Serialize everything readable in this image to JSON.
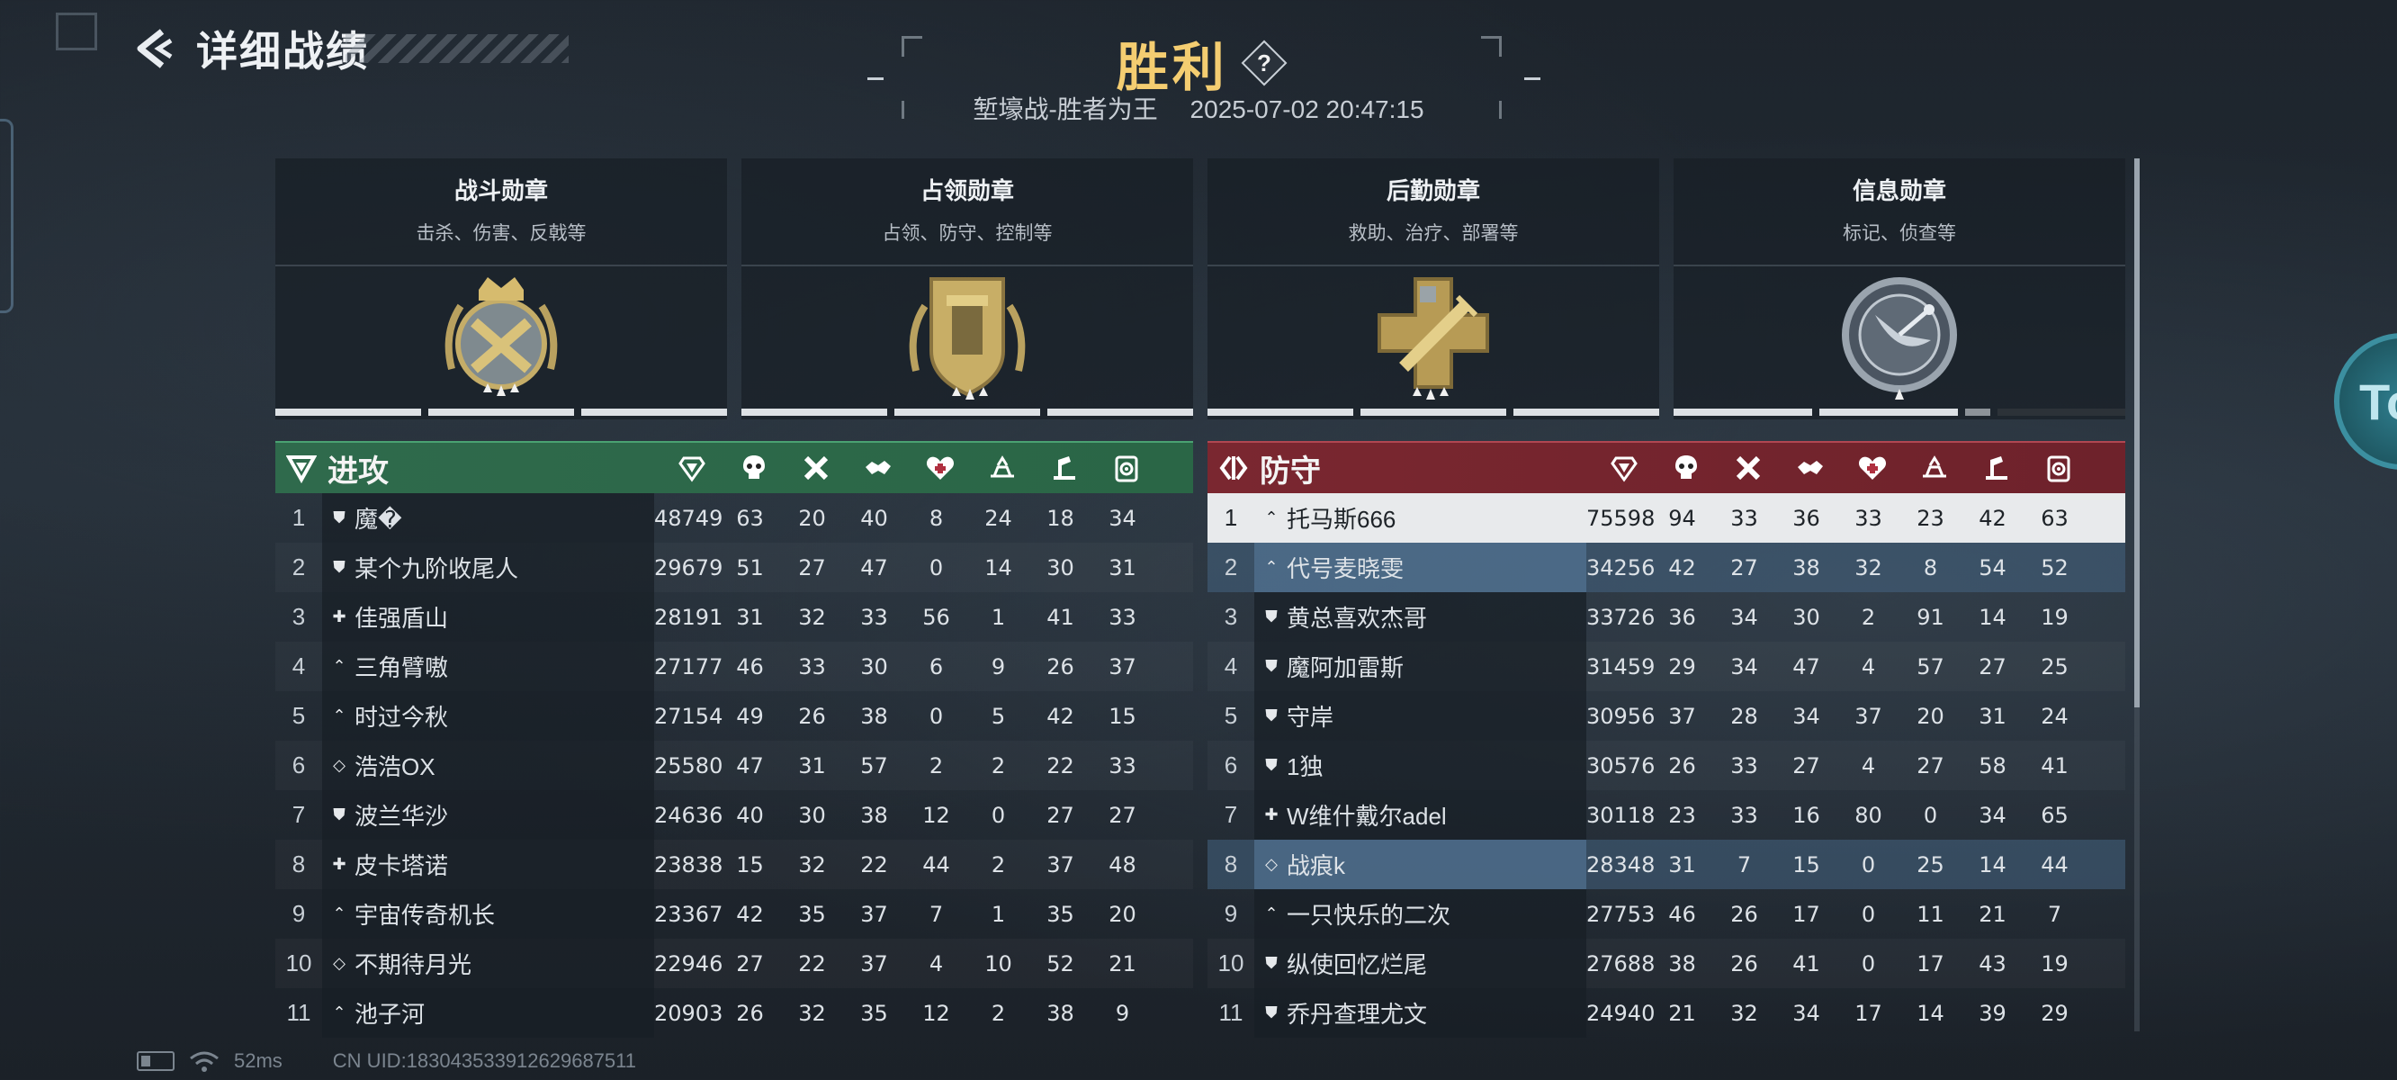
{
  "header": {
    "back_icon": "back-arrow-icon",
    "title": "详细战绩"
  },
  "result": {
    "title": "胜利",
    "help_label": "?",
    "mode": "堑壕战-胜者为王",
    "datetime": "2025-07-02 20:47:15"
  },
  "medals": [
    {
      "name": "战斗勋章",
      "desc": "击杀、伤害、反戟等",
      "icon": "combat-medal-icon",
      "segments_filled": 3
    },
    {
      "name": "占领勋章",
      "desc": "占领、防守、控制等",
      "icon": "capture-medal-icon",
      "segments_filled": 3
    },
    {
      "name": "后勤勋章",
      "desc": "救助、治疗、部署等",
      "icon": "logistics-medal-icon",
      "segments_filled": 3
    },
    {
      "name": "信息勋章",
      "desc": "标记、侦查等",
      "icon": "intel-medal-icon",
      "segments_filled": 2.15
    }
  ],
  "column_icons": [
    "score-icon",
    "kills-icon",
    "deaths-icon",
    "assists-icon",
    "revives-icon",
    "capture-icon",
    "support-icon",
    "intel-icon"
  ],
  "attack": {
    "name": "进攻",
    "color": "#2f6a4c",
    "rows": [
      {
        "rank": "1",
        "role": "shield",
        "name": "魔�",
        "stats": [
          "48749",
          "63",
          "20",
          "40",
          "8",
          "24",
          "18",
          "34"
        ]
      },
      {
        "rank": "2",
        "role": "shield",
        "name": "某个九阶收尾人",
        "stats": [
          "29679",
          "51",
          "27",
          "47",
          "0",
          "14",
          "30",
          "31"
        ]
      },
      {
        "rank": "3",
        "role": "medic",
        "name": "佳强盾山",
        "stats": [
          "28191",
          "31",
          "32",
          "33",
          "56",
          "1",
          "41",
          "33"
        ]
      },
      {
        "rank": "4",
        "role": "assault",
        "name": "三角臂嗷",
        "stats": [
          "27177",
          "46",
          "33",
          "30",
          "6",
          "9",
          "26",
          "37"
        ]
      },
      {
        "rank": "5",
        "role": "assault",
        "name": "时过今秋",
        "stats": [
          "27154",
          "49",
          "26",
          "38",
          "0",
          "5",
          "42",
          "15"
        ]
      },
      {
        "rank": "6",
        "role": "recon",
        "name": "浩浩OX",
        "stats": [
          "25580",
          "47",
          "31",
          "57",
          "2",
          "2",
          "22",
          "33"
        ]
      },
      {
        "rank": "7",
        "role": "shield",
        "name": "波兰华沙",
        "stats": [
          "24636",
          "40",
          "30",
          "38",
          "12",
          "0",
          "27",
          "27"
        ]
      },
      {
        "rank": "8",
        "role": "medic",
        "name": "皮卡塔诺",
        "stats": [
          "23838",
          "15",
          "32",
          "22",
          "44",
          "2",
          "37",
          "48"
        ]
      },
      {
        "rank": "9",
        "role": "assault",
        "name": "宇宙传奇机长",
        "stats": [
          "23367",
          "42",
          "35",
          "37",
          "7",
          "1",
          "35",
          "20"
        ]
      },
      {
        "rank": "10",
        "role": "recon",
        "name": "不期待月光",
        "stats": [
          "22946",
          "27",
          "22",
          "37",
          "4",
          "10",
          "52",
          "21"
        ]
      },
      {
        "rank": "11",
        "role": "assault",
        "name": "池子河",
        "stats": [
          "20903",
          "26",
          "32",
          "35",
          "12",
          "2",
          "38",
          "9"
        ]
      }
    ]
  },
  "defense": {
    "name": "防守",
    "color": "#7a2730",
    "rows": [
      {
        "rank": "1",
        "role": "assault",
        "name": "托马斯666",
        "stats": [
          "75598",
          "94",
          "33",
          "36",
          "33",
          "23",
          "42",
          "63"
        ],
        "state": "me"
      },
      {
        "rank": "2",
        "role": "assault",
        "name": "代号麦晓雯",
        "stats": [
          "34256",
          "42",
          "27",
          "38",
          "32",
          "8",
          "54",
          "52"
        ],
        "state": "hl"
      },
      {
        "rank": "3",
        "role": "shield",
        "name": "黄总喜欢杰哥",
        "stats": [
          "33726",
          "36",
          "34",
          "30",
          "2",
          "91",
          "14",
          "19"
        ]
      },
      {
        "rank": "4",
        "role": "shield",
        "name": "魔阿加雷斯",
        "stats": [
          "31459",
          "29",
          "34",
          "47",
          "4",
          "57",
          "27",
          "25"
        ]
      },
      {
        "rank": "5",
        "role": "shield",
        "name": "守岸",
        "stats": [
          "30956",
          "37",
          "28",
          "34",
          "37",
          "20",
          "31",
          "24"
        ]
      },
      {
        "rank": "6",
        "role": "shield",
        "name": "1独",
        "stats": [
          "30576",
          "26",
          "33",
          "27",
          "4",
          "27",
          "58",
          "41"
        ]
      },
      {
        "rank": "7",
        "role": "medic",
        "name": "W维什戴尔adel",
        "stats": [
          "30118",
          "23",
          "33",
          "16",
          "80",
          "0",
          "34",
          "65"
        ]
      },
      {
        "rank": "8",
        "role": "recon",
        "name": "战痕k",
        "stats": [
          "28348",
          "31",
          "7",
          "15",
          "0",
          "25",
          "14",
          "44"
        ],
        "state": "hl"
      },
      {
        "rank": "9",
        "role": "assault",
        "name": "一只快乐的二次",
        "stats": [
          "27753",
          "46",
          "26",
          "17",
          "0",
          "11",
          "21",
          "7"
        ]
      },
      {
        "rank": "10",
        "role": "shield",
        "name": "纵使回忆烂尾",
        "stats": [
          "27688",
          "38",
          "26",
          "41",
          "0",
          "17",
          "43",
          "19"
        ]
      },
      {
        "rank": "11",
        "role": "shield",
        "name": "乔丹查理尤文",
        "stats": [
          "24940",
          "21",
          "32",
          "34",
          "17",
          "14",
          "39",
          "29"
        ]
      }
    ]
  },
  "footer": {
    "ping": "52ms",
    "uid": "CN UID:1830435339126296875​11"
  },
  "edge_badge": {
    "label": "To"
  }
}
